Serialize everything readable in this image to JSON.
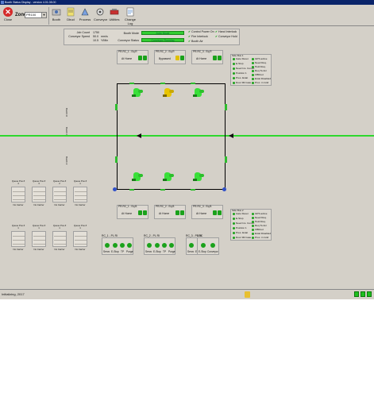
{
  "window": {
    "title": "Booth Status Display - version 4.01.08.00"
  },
  "toolbar": {
    "close_label": "Close",
    "zone_label": "Zone",
    "zone_value": "PR100",
    "buttons": [
      {
        "label": "Booth",
        "icon": "booth-icon"
      },
      {
        "label": "Dbud",
        "icon": "dbud-icon"
      },
      {
        "label": "Process",
        "icon": "process-icon"
      },
      {
        "label": "Conveyor",
        "icon": "conveyor-icon"
      },
      {
        "label": "Utilities",
        "icon": "utilities-icon"
      },
      {
        "label": "Change Log",
        "icon": "change-log-icon"
      }
    ]
  },
  "info": {
    "job_count_label": "Job Count",
    "job_count_value": "1750",
    "conveyor_speed_label": "Conveyor Speed",
    "conveyor_speed_value": "50.0",
    "conveyor_speed_unit": "mm/s",
    "third_value": "10.5",
    "third_unit": "Y/Min",
    "booth_mode_label": "Booth Mode",
    "booth_mode_value": "Auto Mode",
    "conveyor_status_label": "Conveyor Status",
    "conveyor_status_value": "Conveyor Running",
    "checks_col1": [
      "Control Power On",
      "Fire Interlock",
      "Booth Air"
    ],
    "checks_col2": [
      "Hand Interlock",
      "Conveyor Hold"
    ]
  },
  "top_panels": [
    {
      "title": "PR-RC_1 - Eq.R",
      "value": "At Home"
    },
    {
      "title": "PR-RC_2 - Eq.R",
      "value": "Bypassed"
    },
    {
      "title": "PR-RC_3 - Eq.R",
      "value": "At Home"
    }
  ],
  "bottom_panels": [
    {
      "title": "PR-RC_1 - Eq.B",
      "value": "At Home"
    },
    {
      "title": "PR-RC_2 - Eq.B",
      "value": "At Home"
    },
    {
      "title": "PR-RC_3 - Eq.B",
      "value": "At Home"
    }
  ],
  "side_panels": [
    {
      "title": "Side Bus 1",
      "col1": [
        "Gate Reset",
        "E-Stop",
        "Need Ins. Comm.",
        "Position 1",
        "Pres. Estat",
        "Door Mtl Gate"
      ],
      "col2": [
        "GPS active",
        "Need Req.",
        "Hold Req.",
        "Req To Arc",
        "CBRoot",
        "Estat Disabled",
        "Proc. in Grid"
      ]
    },
    {
      "title": "Side Bus 2",
      "col1": [
        "Gate Reset",
        "E-Stop",
        "Need Ins. Comm.",
        "Position 1",
        "Pres. Estat",
        "Door Mtl Gate"
      ],
      "col2": [
        "GPS active",
        "Need Req.",
        "Hold Req.",
        "Req To Arc",
        "CBRoot",
        "Estat Disabled",
        "Proc. in Grid"
      ]
    }
  ],
  "booth_side_labels": [
    "Booth R",
    "Booth F",
    "Booth 2"
  ],
  "queues_row1": [
    {
      "title": "Queue Pos #",
      "num": "4",
      "footer": "No Carrier"
    },
    {
      "title": "Queue Pos #",
      "num": "3",
      "footer": "No Carrier"
    },
    {
      "title": "Queue Pos #",
      "num": "2",
      "footer": "No Carrier"
    },
    {
      "title": "Queue Pos #",
      "num": "1",
      "footer": "No Carrier"
    }
  ],
  "queues_row2": [
    {
      "title": "Queue Pos #",
      "num": "1",
      "footer": "No Carrier"
    },
    {
      "title": "Queue Pos #",
      "num": "1",
      "footer": "No Carrier"
    },
    {
      "title": "Queue Pos #",
      "num": "1",
      "footer": "No Carrier"
    },
    {
      "title": "Queue Pos #",
      "num": "1",
      "footer": "No Carrier"
    }
  ],
  "bottom_groups": [
    {
      "title": "RC_1 - PL RI",
      "labels": [
        "Servo",
        "E-Stop",
        "TP",
        "Purge"
      ]
    },
    {
      "title": "RC_2 - PL RI",
      "labels": [
        "Servo",
        "E-Stop",
        "TP",
        "Purge"
      ]
    },
    {
      "title": "RC_3 - PL RI",
      "labels": [
        "Servo",
        "E-Stop",
        "TP",
        "Purge"
      ]
    }
  ],
  "cc_group": {
    "title": "SOC",
    "labels": [
      "E-Stop",
      "Conveyor"
    ]
  },
  "status": {
    "text": "Initializing, 2017"
  },
  "colors": {
    "ok": "#1ba21b",
    "bypass": "#e0c000",
    "conveyor": "#2ed82e",
    "robot_green": "#39e039",
    "robot_yellow": "#e8c400"
  }
}
